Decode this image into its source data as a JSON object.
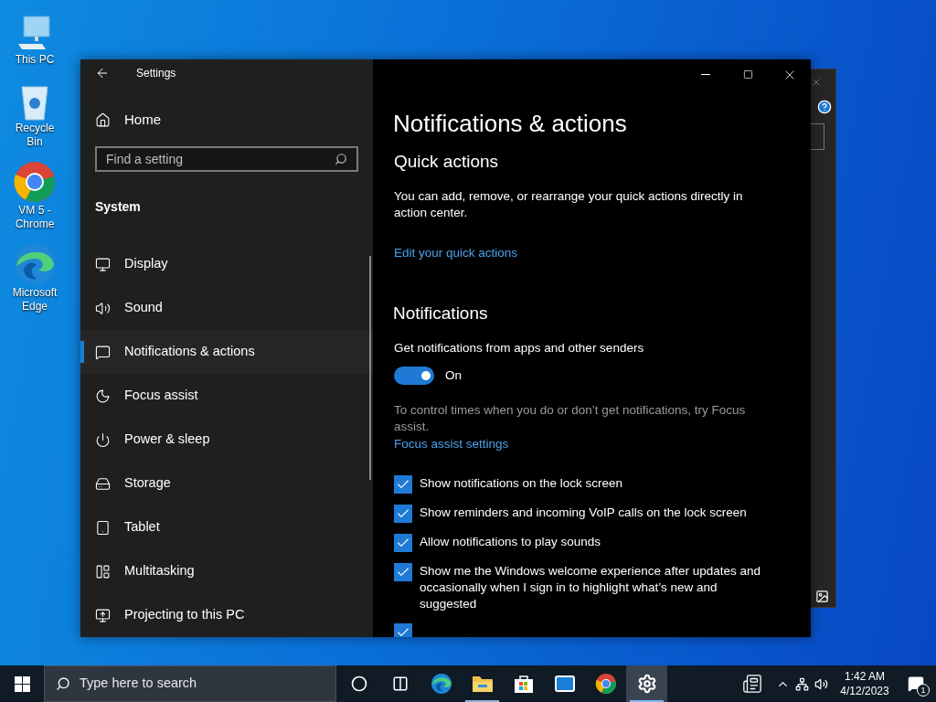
{
  "desktop_icons": [
    {
      "label": "This PC",
      "kind": "pc"
    },
    {
      "label": "Recycle Bin",
      "kind": "bin"
    },
    {
      "label": "VM 5 - Chrome",
      "kind": "chrome"
    },
    {
      "label": "Microsoft Edge",
      "kind": "edge"
    }
  ],
  "window": {
    "title": "Settings"
  },
  "sidebar": {
    "home": "Home",
    "search": {
      "placeholder": "Find a setting"
    },
    "group": "System",
    "items": [
      {
        "label": "Display",
        "selected": false
      },
      {
        "label": "Sound",
        "selected": false
      },
      {
        "label": "Notifications & actions",
        "selected": true
      },
      {
        "label": "Focus assist",
        "selected": false
      },
      {
        "label": "Power & sleep",
        "selected": false
      },
      {
        "label": "Storage",
        "selected": false
      },
      {
        "label": "Tablet",
        "selected": false
      },
      {
        "label": "Multitasking",
        "selected": false
      },
      {
        "label": "Projecting to this PC",
        "selected": false
      }
    ]
  },
  "page": {
    "title": "Notifications & actions",
    "quick_actions": {
      "heading": "Quick actions",
      "description": "You can add, remove, or rearrange your quick actions directly in action center.",
      "link": "Edit your quick actions"
    },
    "notifications": {
      "heading": "Notifications",
      "toggle_label": "Get notifications from apps and other senders",
      "toggle": {
        "on": true,
        "state_text": "On"
      },
      "hint": "To control times when you do or don’t get notifications, try Focus assist.",
      "link": "Focus assist settings",
      "checkboxes": [
        {
          "label": "Show notifications on the lock screen",
          "checked": true
        },
        {
          "label": "Show reminders and incoming VoIP calls on the lock screen",
          "checked": true
        },
        {
          "label": "Allow notifications to play sounds",
          "checked": true
        },
        {
          "label": "Show me the Windows welcome experience after updates and occasionally when I sign in to highlight what’s new and suggested",
          "checked": true
        }
      ],
      "partial_checkbox": {
        "checked": true
      }
    }
  },
  "taskbar": {
    "search": {
      "placeholder": "Type here to search"
    },
    "apps": [
      {
        "kind": "cortana",
        "running": false,
        "selected": false
      },
      {
        "kind": "taskview",
        "running": false,
        "selected": false
      },
      {
        "kind": "edge",
        "running": false,
        "selected": false
      },
      {
        "kind": "explorer",
        "running": true,
        "selected": false
      },
      {
        "kind": "store",
        "running": false,
        "selected": false
      },
      {
        "kind": "mail",
        "running": false,
        "selected": false
      },
      {
        "kind": "chrome",
        "running": false,
        "selected": false
      },
      {
        "kind": "settings",
        "running": true,
        "selected": true
      }
    ],
    "time": "1:42 AM",
    "date": "4/12/2023",
    "notification_count": "1"
  }
}
